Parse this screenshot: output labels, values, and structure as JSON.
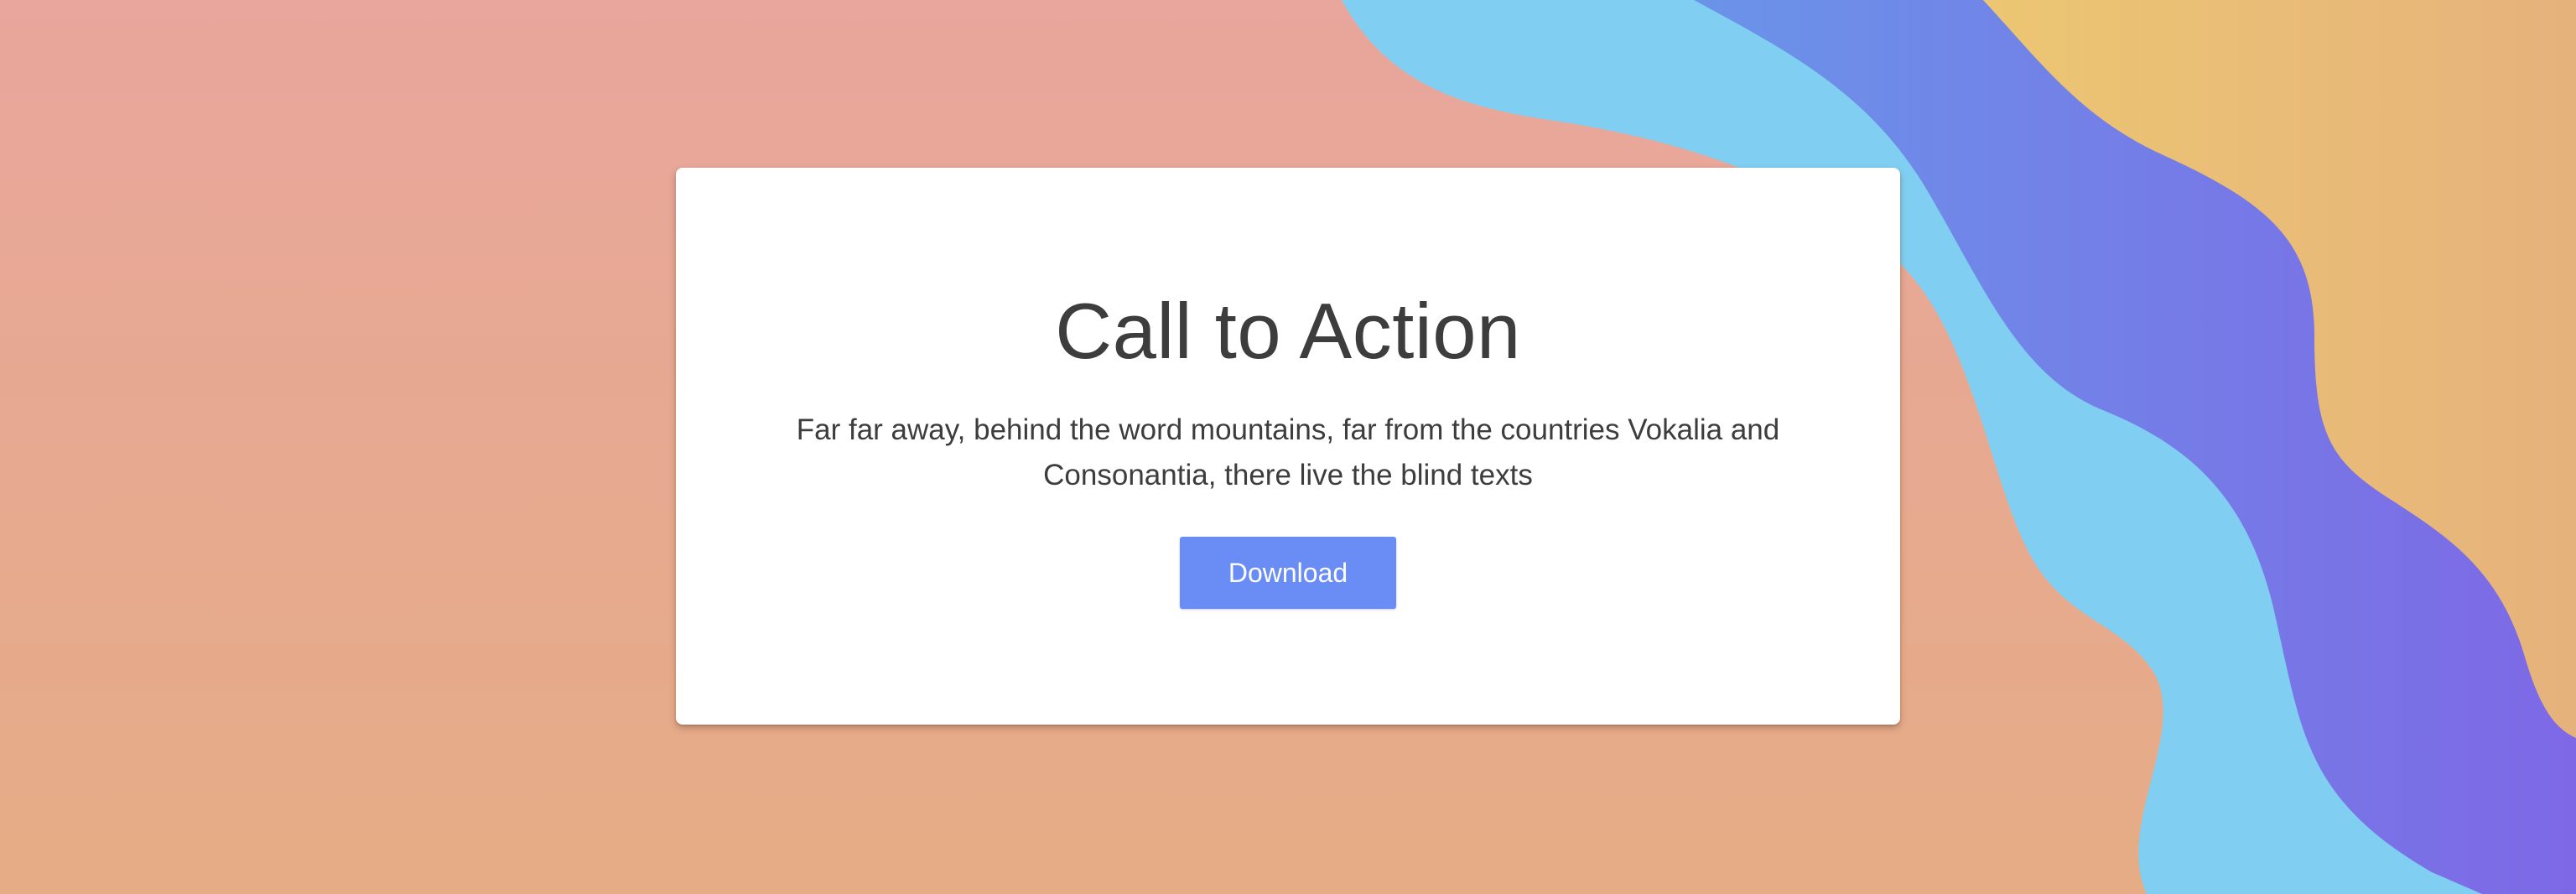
{
  "cta": {
    "title": "Call to Action",
    "description": "Far far away, behind the word mountains, far from the countries Vokalia and Consonantia, there live the blind texts",
    "button_label": "Download"
  },
  "colors": {
    "background_top": "#e8a69c",
    "background_bottom": "#e6ac85",
    "wave_light_blue": "#80cff2",
    "wave_blue": "#6b8ce8",
    "wave_purple": "#7b6ee6",
    "wave_yellow": "#ebc573",
    "card_background": "#ffffff",
    "button_background": "#6a8df5",
    "text": "#3d3d3d"
  }
}
